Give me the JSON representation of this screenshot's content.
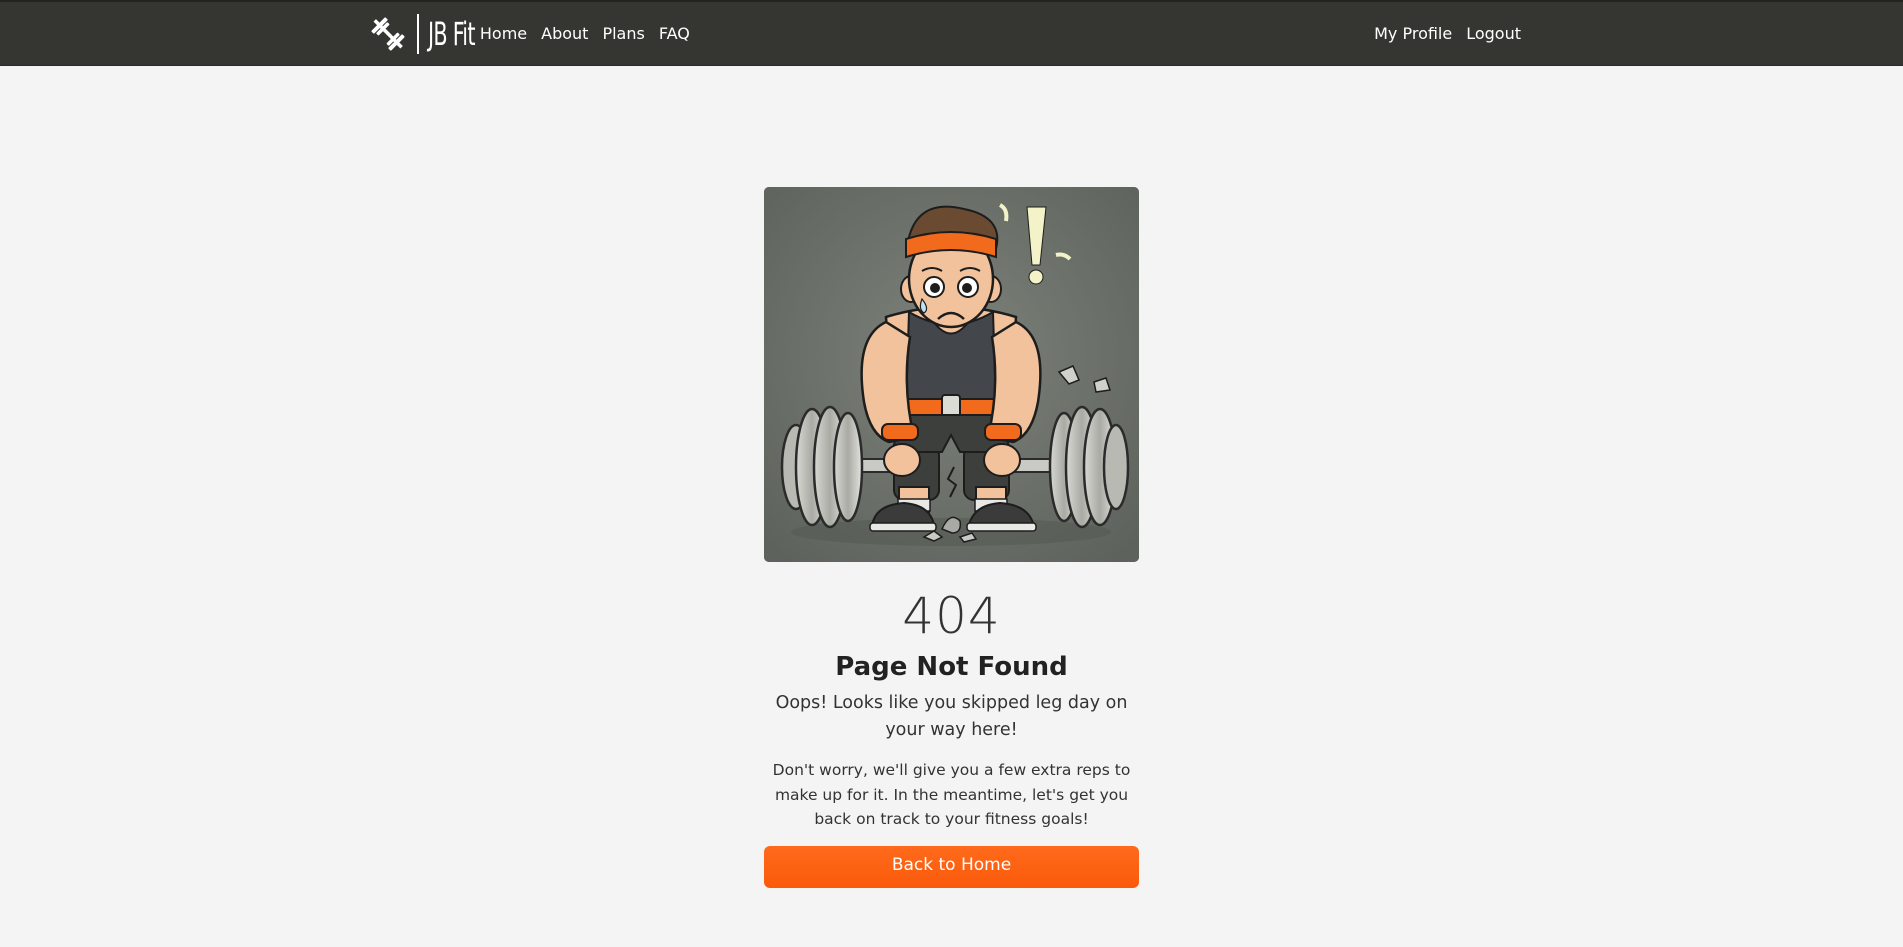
{
  "brand": {
    "name": "JB Fit",
    "logo_icon": "barbell-icon"
  },
  "nav": {
    "left": [
      {
        "label": "Home"
      },
      {
        "label": "About"
      },
      {
        "label": "Plans"
      },
      {
        "label": "FAQ"
      }
    ],
    "right": [
      {
        "label": "My Profile"
      },
      {
        "label": "Logout"
      }
    ]
  },
  "error": {
    "illustration": "404-weightlifter-broken-barbell-illustration",
    "code": "404",
    "title": "Page Not Found",
    "lead": "Oops! Looks like you skipped leg day on your way here!",
    "message": "Don't worry, we'll give you a few extra reps to make up for it. In the meantime, let's get you back on track to your fitness goals!",
    "button_label": "Back to Home"
  },
  "colors": {
    "navbar": "#353531",
    "page_background": "#f4f4f4",
    "accent": "#fa5a0a"
  }
}
